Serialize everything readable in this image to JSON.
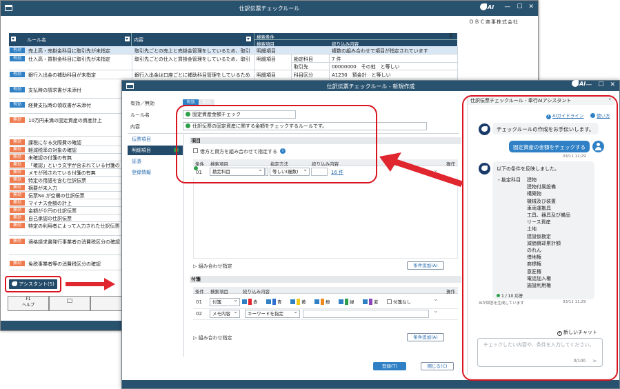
{
  "back_window": {
    "title": "仕訳伝票チェックルール",
    "company": "ＯＢＣ商事株式会社",
    "columns": {
      "rule_name": "ルール名",
      "content": "内容",
      "search_cond": "検索条件",
      "search_item": "検索項目",
      "filter": "絞り込み内容"
    },
    "rows": [
      {
        "status": "有効",
        "name": "売上高・売掛金科目に取引先が未指定",
        "content": "取引先ごとの売上と売掛金管理をしているため、取引",
        "item": "明細項目",
        "sub": "",
        "filter": "複数の組み合わせで項目が指定されています",
        "selected": true
      },
      {
        "status": "有効",
        "name": "仕入高・買掛金科目に取引先が未指定",
        "content": "取引先ごとの仕入と買掛金管理をしているため、取引",
        "item": "明細項目",
        "sub": "勘定科目",
        "filter": "7 件"
      },
      {
        "status": "",
        "name": "",
        "content": "",
        "item": "",
        "sub": "取引先",
        "filter": "00000000　その他　と等しい"
      },
      {
        "status": "有効",
        "name": "銀行入出金の補助科目が未指定",
        "content": "銀行入出金は口座ごとに補助科目管理をしているため",
        "item": "明細項目",
        "sub": "科目区分",
        "filter": "A1230　預金計　と等しい"
      },
      {
        "status": "有効",
        "name": "支払時の請求書が未添付"
      },
      {
        "status": "有効",
        "name": "経費支払時の領収書が未添付"
      },
      {
        "status": "無効",
        "name": "10万円未満の固定資産の資産計上"
      },
      {
        "status": "無効",
        "name": "課税になる交際費の確認"
      },
      {
        "status": "無効",
        "name": "軽減税率の対象の確認"
      },
      {
        "status": "無効",
        "name": "未確認の付箋の有無"
      },
      {
        "status": "無効",
        "name": "「確認」という文字が含まれている付箋の"
      },
      {
        "status": "無効",
        "name": "メモが残されている付箋の有無"
      },
      {
        "status": "無効",
        "name": "特定の用語を含む仕訳伝票"
      },
      {
        "status": "無効",
        "name": "摘要が未入力"
      },
      {
        "status": "無効",
        "name": "伝票No.が空欄の仕訳伝票"
      },
      {
        "status": "無効",
        "name": "マイナス金額の計上"
      },
      {
        "status": "無効",
        "name": "金額が０円の仕訳伝票"
      },
      {
        "status": "無効",
        "name": "自己承認の仕訳伝票"
      },
      {
        "status": "無効",
        "name": "特定の利用者によって入力された仕訳伝票"
      },
      {
        "status": "無効",
        "name": "適格請求書発行事業者の消費税区分の確認"
      },
      {
        "status": "無効",
        "name": "免税事業者等の消費税区分の確認"
      }
    ],
    "assistant_button": "アシスタント(S)",
    "fkeys": [
      {
        "key": "F1",
        "label": "ヘルプ"
      },
      {
        "key": "",
        "label": ""
      },
      {
        "key": "",
        "label": ""
      }
    ]
  },
  "front_window": {
    "title": "仕訳伝票チェックルール - 新規作成",
    "labels": {
      "enable": "有効／無効",
      "rule_name": "ルール名",
      "content": "内容"
    },
    "toggle": {
      "on": "有効",
      "off": "無効"
    },
    "rule_name_value": "固定資産金額チェック",
    "content_value": "仕訳伝票の固定資産に関する金額をチェックするルールです。",
    "sidebar": [
      "伝票項目",
      "明細項目",
      "証憑",
      "登録情報"
    ],
    "detail": {
      "section": "項目",
      "checkbox_label": "借方と貸方を組み合わせて指定する",
      "cols": {
        "cond": "条件",
        "item": "検索項目",
        "method": "指定方法",
        "filter": "絞り込み内容",
        "op": "操作"
      },
      "row": {
        "no": "01",
        "item": "勘定科目",
        "method": "等しい(複数)",
        "link": "16 件"
      },
      "combine": "組み合わせ指定",
      "add_btn": "条件追加(A)"
    },
    "fusen": {
      "section": "付箋",
      "cols": {
        "cond": "条件",
        "item": "検索項目",
        "filter": "絞り込み内容",
        "op": "操作"
      },
      "row1": {
        "no": "01",
        "item": "付箋"
      },
      "colors": [
        {
          "label": "赤",
          "color": "#e0262e"
        },
        {
          "label": "青",
          "color": "#2f6fd0"
        },
        {
          "label": "黄",
          "color": "#f2c81a"
        },
        {
          "label": "橙",
          "color": "#f08a1c"
        },
        {
          "label": "緑",
          "color": "#2fa04a"
        },
        {
          "label": "紫",
          "color": "#8a46b8"
        }
      ],
      "no_fusen": "付箋なし",
      "row2": {
        "no": "02",
        "item": "メモ内容",
        "method": "キーワードを指定"
      },
      "combine": "組み合わせ指定",
      "add_btn": "条件追加(A)"
    },
    "register_btn": "登録(T)",
    "close_btn": "閉じる(C)"
  },
  "assistant": {
    "title": "仕訳伝票チェックルール - 奉行AIアシスタント",
    "guide_link": "AIガイドライン",
    "howto_link": "使い方",
    "msg1": "チェックルールの作成をお手伝いします。",
    "user_msg": "固定資産の金額をチェックする",
    "user_time": "03/11 11:29",
    "reply_intro": "以下の条件を反映しました。",
    "reply_key": "・勘定科目",
    "reply_items": [
      "建物",
      "建物付属設備",
      "構築物",
      "機械及び装置",
      "車両運搬具",
      "工具、器具及び備品",
      "リース資産",
      "土地",
      "建設仮勘定",
      "減価償却累計額",
      "のれん",
      "借地権",
      "商標権",
      "意匠権",
      "電話加入権",
      "施設利用権"
    ],
    "reply_count": "1 / 10 応答",
    "reply_time": "03/11 11:29",
    "generating": "AIが回答を生成しています",
    "new_chat": "新しいチャット",
    "placeholder": "チェックしたい内容や、条件を入力してください。",
    "counter": "0/100"
  }
}
